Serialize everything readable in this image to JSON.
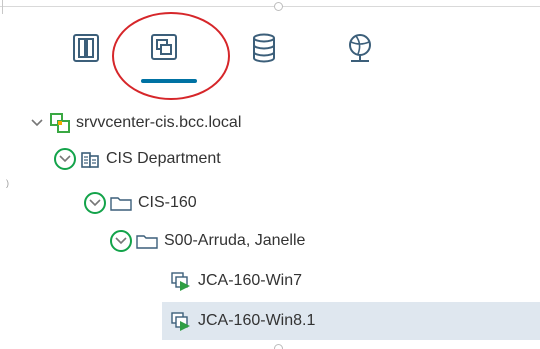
{
  "tabs": [
    {
      "name": "hosts-and-clusters",
      "icon": "hosts-clusters-icon"
    },
    {
      "name": "vms-and-templates",
      "icon": "vms-templates-icon",
      "selected": true
    },
    {
      "name": "storage",
      "icon": "storage-icon"
    },
    {
      "name": "networking",
      "icon": "networking-icon"
    }
  ],
  "tree": {
    "vcenter": {
      "label": "srvvcenter-cis.bcc.local",
      "icon": "vcenter-icon"
    },
    "datacenter": {
      "label": "CIS Department",
      "icon": "datacenter-icon"
    },
    "folder1": {
      "label": "CIS-160",
      "icon": "folder-icon"
    },
    "folder2": {
      "label": "S00-Arruda, Janelle",
      "icon": "folder-icon"
    },
    "vm1": {
      "label": "JCA-160-Win7",
      "icon": "vm-icon"
    },
    "vm2": {
      "label": "JCA-160-Win8.1",
      "icon": "vm-icon",
      "selected": true
    }
  },
  "colors": {
    "accent": "#0072a3",
    "selected_row": "#dfe7ef",
    "annotation_red": "#d6262a",
    "annotation_green": "#13a34a",
    "vm_green": "#2f9e44"
  }
}
